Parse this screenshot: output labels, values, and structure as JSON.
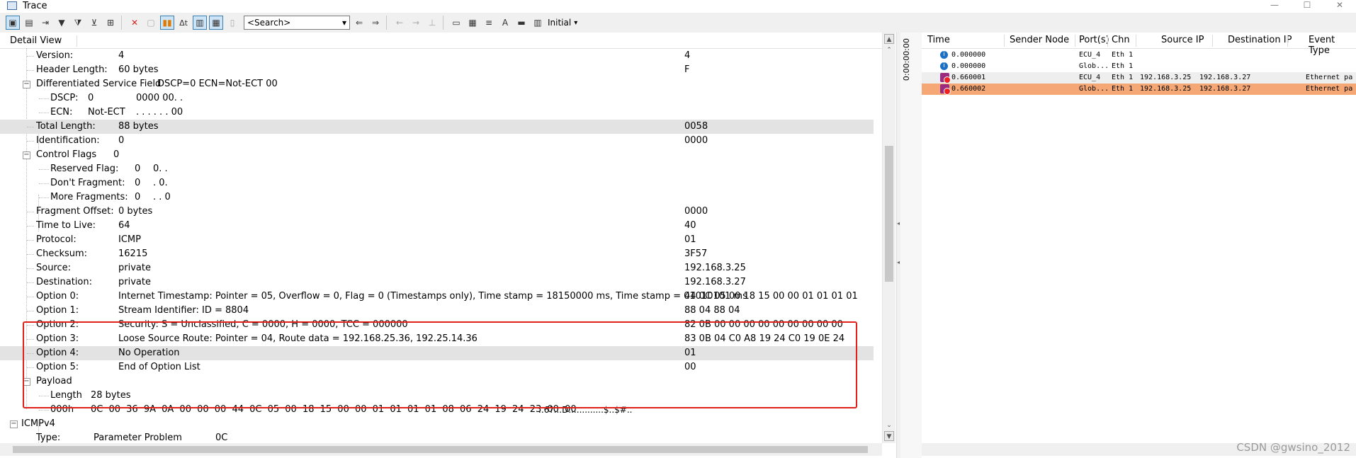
{
  "window": {
    "title": "Trace"
  },
  "toolbar": {
    "search_placeholder": "<Search>",
    "initial_label": "Initial"
  },
  "detail": {
    "tab_label": "Detail View",
    "rows": [
      {
        "label": "Version:",
        "value": "4",
        "raw": "4"
      },
      {
        "label": "Header Length:",
        "value": "60 bytes",
        "raw": "F"
      },
      {
        "label": "Differentiated Service Field",
        "value": "DSCP=0 ECN=Not-ECT   00",
        "raw": ""
      },
      {
        "label": "DSCP:",
        "value": "0",
        "bits": "0000 00. .",
        "raw": ""
      },
      {
        "label": "ECN:",
        "value": "Not-ECT",
        "bits": ". . . . . . 00",
        "raw": ""
      },
      {
        "label": "Total Length:",
        "value": "88 bytes",
        "raw": "0058"
      },
      {
        "label": "Identification:",
        "value": "0",
        "raw": "0000"
      },
      {
        "label": "Control Flags",
        "value": "0",
        "raw": ""
      },
      {
        "label": "Reserved Flag:",
        "value": "0",
        "bits": "0. .",
        "raw": ""
      },
      {
        "label": "Don't Fragment:",
        "value": "0",
        "bits": ". 0.",
        "raw": ""
      },
      {
        "label": "More Fragments:",
        "value": "0",
        "bits": ". . 0",
        "raw": ""
      },
      {
        "label": "Fragment Offset:",
        "value": "0 bytes",
        "raw": "0000"
      },
      {
        "label": "Time to Live:",
        "value": "64",
        "raw": "40"
      },
      {
        "label": "Protocol:",
        "value": "ICMP",
        "raw": "01"
      },
      {
        "label": "Checksum:",
        "value": "16215",
        "raw": "3F57"
      },
      {
        "label": "Source:",
        "value": "private",
        "raw": "192.168.3.25"
      },
      {
        "label": "Destination:",
        "value": "private",
        "raw": "192.168.3.27"
      },
      {
        "label": "Option 0:",
        "value": "Internet Timestamp: Pointer = 05, Overflow = 0, Flag = 0 (Timestamps only), Time stamp = 18150000 ms, Time stamp = 01010101 ms",
        "raw": "44 0C 05 00 18 15 00 00 01 01 01 01"
      },
      {
        "label": "Option 1:",
        "value": "Stream Identifier: ID = 8804",
        "raw": "88 04 88 04"
      },
      {
        "label": "Option 2:",
        "value": "Security: S = Unclassified, C = 0000, H = 0000, TCC = 000000",
        "raw": "82 0B 00 00 00 00 00 00 00 00 00"
      },
      {
        "label": "Option 3:",
        "value": "Loose Source Route: Pointer = 04, Route data = 192.168.25.36, 192.25.14.36",
        "raw": "83 0B 04 C0 A8 19 24 C0 19 0E 24"
      },
      {
        "label": "Option 4:",
        "value": "No Operation",
        "raw": "01"
      },
      {
        "label": "Option 5:",
        "value": "End of Option List",
        "raw": "00"
      },
      {
        "label": "Payload",
        "value": "",
        "raw": ""
      },
      {
        "label": "Length",
        "value": "28 bytes",
        "raw": ""
      },
      {
        "label": "000h",
        "value": "0C 00 36 9A 0A 00 00 00 44 0C 05 00 18 15 00 00 01 01 01 01 08 06 24 19 24 23 00 00",
        "ascii": "..6?...D.............$..$#..",
        "raw": ""
      },
      {
        "label": "ICMPv4",
        "value": "",
        "raw": ""
      },
      {
        "label": "Type:",
        "value": "Parameter Problem",
        "raw": "0C"
      }
    ]
  },
  "timerail": {
    "label": "0:00:00:00"
  },
  "trace": {
    "columns": [
      "Time",
      "Sender Node",
      "Port(s)",
      "Chn",
      "Source IP",
      "Destination IP",
      "Event Type"
    ],
    "rows": [
      {
        "time": "0.000000",
        "sender": "ECU_4",
        "chn": "Eth 1",
        "src": "",
        "dst": "",
        "event": ""
      },
      {
        "time": "0.000000",
        "sender": "Glob...",
        "chn": "Eth 1",
        "src": "",
        "dst": "",
        "event": ""
      },
      {
        "time": "0.660001",
        "sender": "ECU_4",
        "chn": "Eth 1",
        "src": "192.168.3.25",
        "dst": "192.168.3.27",
        "event": "Ethernet pa"
      },
      {
        "time": "0.660002",
        "sender": "Glob...",
        "chn": "Eth 1",
        "src": "192.168.3.25",
        "dst": "192.168.3.27",
        "event": "Ethernet pa"
      }
    ]
  },
  "watermark": "CSDN @gwsino_2012",
  "colors": {
    "highlight_box": "#e0201a",
    "selected_row": "#f5a876",
    "row_highlight": "#e3e3e3"
  }
}
